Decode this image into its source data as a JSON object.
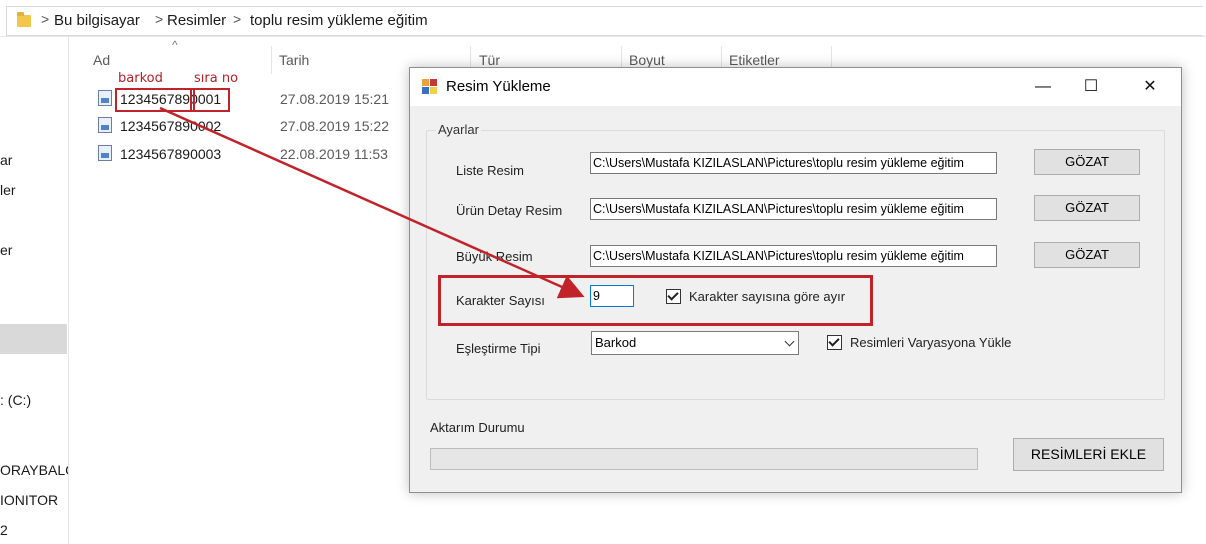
{
  "breadcrumb": {
    "items": [
      "Bu bilgisayar",
      "Resimler",
      "toplu resim yükleme eğitim"
    ],
    "separator": ">"
  },
  "nav": {
    "items": [
      "ar",
      "ler",
      "er",
      ": (C:)",
      "ORAYBALCI",
      "IONITOR",
      "2"
    ]
  },
  "file_list": {
    "columns": [
      "Ad",
      "Tarih",
      "Tür",
      "Boyut",
      "Etiketler"
    ],
    "rows": [
      {
        "name": "1234567890001",
        "date": "27.08.2019 15:21"
      },
      {
        "name": "1234567890002",
        "date": "27.08.2019 15:22"
      },
      {
        "name": "1234567890003",
        "date": "22.08.2019 11:53"
      }
    ]
  },
  "annotations": {
    "barcode_label": "barkod",
    "seq_label": "sıra no",
    "barcode_part": "123456789",
    "seq_part": "0001",
    "color": "#c0242a"
  },
  "dialog": {
    "title": "Resim Yükleme",
    "minimize": "—",
    "maximize": "☐",
    "close": "✕",
    "group_title": "Ayarlar",
    "liste_resim": {
      "label": "Liste Resim",
      "value": "C:\\Users\\Mustafa KIZILASLAN\\Pictures\\toplu resim yükleme eğitim",
      "button": "GÖZAT"
    },
    "urun_detay_resim": {
      "label": "Ürün Detay Resim",
      "value": "C:\\Users\\Mustafa KIZILASLAN\\Pictures\\toplu resim yükleme eğitim",
      "button": "GÖZAT"
    },
    "buyuk_resim": {
      "label": "Büyük Resim",
      "value": "C:\\Users\\Mustafa KIZILASLAN\\Pictures\\toplu resim yükleme eğitim",
      "button": "GÖZAT"
    },
    "karakter_sayisi": {
      "label": "Karakter Sayısı",
      "value": "9",
      "checkbox_label": "Karakter sayısına göre ayır",
      "checked": true
    },
    "eslestirme_tipi": {
      "label": "Eşleştirme Tipi",
      "selected": "Barkod",
      "checkbox_label": "Resimleri Varyasyona Yükle",
      "checked": true
    },
    "aktarim_durumu": {
      "label": "Aktarım Durumu",
      "progress": 0
    },
    "add_button": "RESİMLERİ EKLE"
  }
}
